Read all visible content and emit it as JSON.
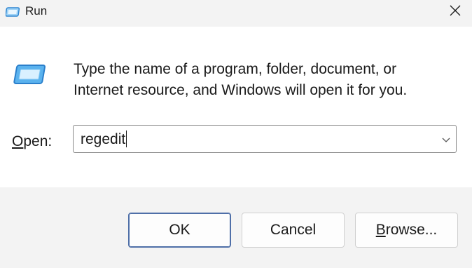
{
  "window": {
    "title": "Run",
    "title_icon": "run-icon",
    "close_icon": "close-icon"
  },
  "content": {
    "icon": "run-icon",
    "description_line1": "Type the name of a program, folder, document, or",
    "description_line2": "Internet resource, and Windows will open it for you.",
    "open_label_accel": "O",
    "open_label_rest": "pen:",
    "open_value": "regedit",
    "dropdown_icon": "chevron-down-icon"
  },
  "buttons": {
    "ok": "OK",
    "cancel": "Cancel",
    "browse_accel": "B",
    "browse_rest": "rowse..."
  },
  "colors": {
    "accent_border": "#4f6fa8",
    "icon_blue": "#3a8fd6",
    "icon_light": "#9fd3f7"
  }
}
